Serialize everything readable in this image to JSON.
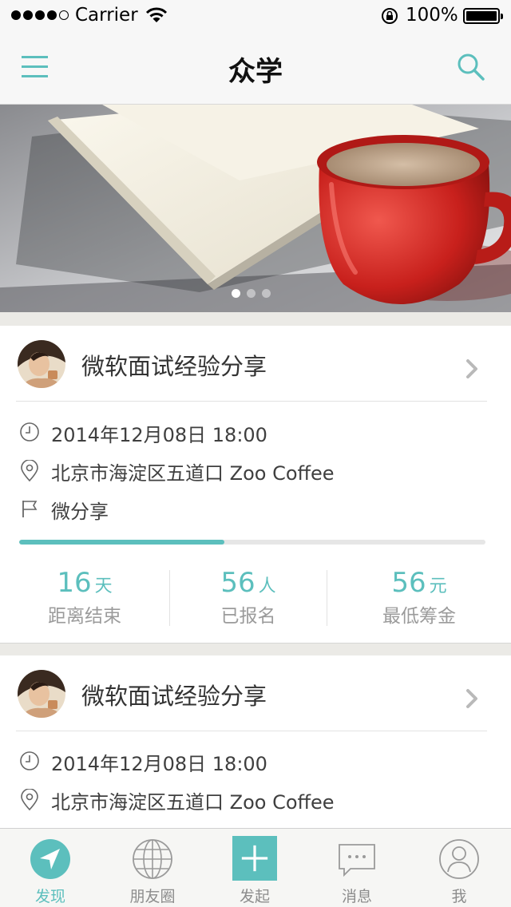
{
  "status_bar": {
    "carrier": "Carrier",
    "battery": "100%"
  },
  "nav": {
    "title": "众学",
    "menu_icon": "menu-icon",
    "search_icon": "search-icon"
  },
  "banner": {
    "page_count": 3,
    "active_page": 1
  },
  "events": [
    {
      "title": "微软面试经验分享",
      "datetime": "2014年12月08日  18:00",
      "location": "北京市海淀区五道口 Zoo Coffee",
      "category": "微分享",
      "progress": 0.44,
      "stats": [
        {
          "value": "16",
          "unit": "天",
          "label": "距离结束"
        },
        {
          "value": "56",
          "unit": "人",
          "label": "已报名"
        },
        {
          "value": "56",
          "unit": "元",
          "label": "最低筹金"
        }
      ]
    },
    {
      "title": "微软面试经验分享",
      "datetime": "2014年12月08日  18:00",
      "location": "北京市海淀区五道口 Zoo Coffee"
    }
  ],
  "tabs": [
    {
      "label": "发现",
      "icon": "compass-icon",
      "active": true
    },
    {
      "label": "朋友圈",
      "icon": "globe-icon",
      "active": false
    },
    {
      "label": "发起",
      "icon": "plus-icon",
      "active": false
    },
    {
      "label": "消息",
      "icon": "message-icon",
      "active": false
    },
    {
      "label": "我",
      "icon": "user-icon",
      "active": false
    }
  ],
  "colors": {
    "accent": "#5cbfbd",
    "text": "#333333",
    "muted": "#9b9b9b",
    "background": "#ebeae6"
  }
}
